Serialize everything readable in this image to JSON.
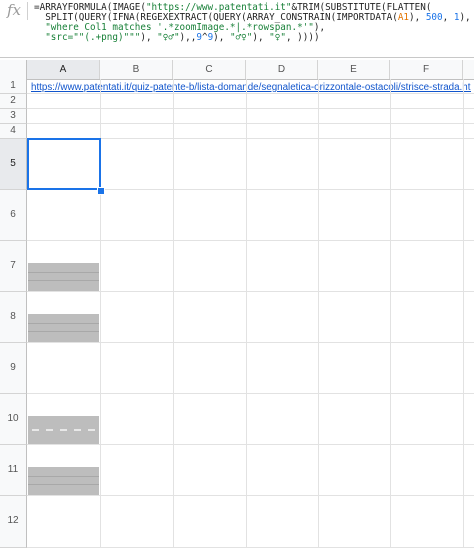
{
  "formula_bar": {
    "icon": "fx-icon",
    "label": "fx",
    "lines": [
      [
        {
          "t": "=ARRAYFORMULA(IMAGE(",
          "c": ""
        },
        {
          "t": "\"https://www.patentati.it\"",
          "c": "str"
        },
        {
          "t": "&TRIM(SUBSTITUTE(FLATTEN(",
          "c": ""
        }
      ],
      [
        {
          "t": "  SPLIT(QUERY(IFNA(REGEXEXTRACT(QUERY(ARRAY_CONSTRAIN(IMPORTDATA(",
          "c": ""
        },
        {
          "t": "A1",
          "c": "ref"
        },
        {
          "t": "), ",
          "c": ""
        },
        {
          "t": "500",
          "c": "num"
        },
        {
          "t": ", ",
          "c": ""
        },
        {
          "t": "1",
          "c": "num"
        },
        {
          "t": "),",
          "c": ""
        }
      ],
      [
        {
          "t": "  ",
          "c": ""
        },
        {
          "t": "\"where Col1 matches '.*zoomImage.*|.*rowspan.*'\"",
          "c": "str"
        },
        {
          "t": "),",
          "c": ""
        }
      ],
      [
        {
          "t": "  ",
          "c": ""
        },
        {
          "t": "\"src=\"\"(.+png)\"\"\"",
          "c": "str"
        },
        {
          "t": "), ",
          "c": ""
        },
        {
          "t": "\"♀♂\"",
          "c": "str"
        },
        {
          "t": "),,",
          "c": ""
        },
        {
          "t": "9",
          "c": "num"
        },
        {
          "t": "^",
          "c": ""
        },
        {
          "t": "9",
          "c": "num"
        },
        {
          "t": "), ",
          "c": ""
        },
        {
          "t": "\"♂♀\"",
          "c": "str"
        },
        {
          "t": "), ",
          "c": ""
        },
        {
          "t": "\"♀\"",
          "c": "str"
        },
        {
          "t": ", ))))",
          "c": ""
        }
      ]
    ]
  },
  "sheet": {
    "columns": [
      "A",
      "B",
      "C",
      "D",
      "E",
      "F"
    ],
    "selected_column": "A",
    "rows": [
      "1",
      "2",
      "3",
      "4",
      "5",
      "6",
      "7",
      "8",
      "9",
      "10",
      "11",
      "12"
    ],
    "selected_row": "5",
    "a1_link": "https://www.patentati.it/quiz-patente-b/lista-domande/segnaletica-orizzontale-ostacoli/strisce-strada.html",
    "images": [
      {
        "row": "7",
        "kind": "double-solid"
      },
      {
        "row": "8",
        "kind": "double-solid"
      },
      {
        "row": "10",
        "kind": "dashed-center"
      },
      {
        "row": "11",
        "kind": "double-solid"
      }
    ]
  }
}
